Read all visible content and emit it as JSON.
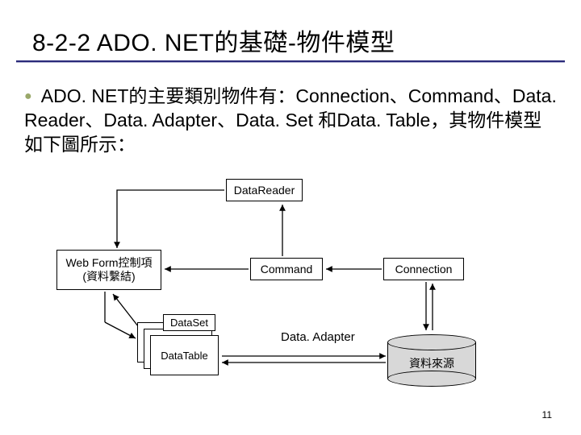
{
  "title": "8-2-2 ADO. NET的基礎-物件模型",
  "bullet": "ADO. NET的主要類別物件有：Connection、Command、Data. Reader、Data. Adapter、Data. Set 和Data. Table，其物件模型如下圖所示：",
  "diagram": {
    "datareader": "DataReader",
    "webform_line1": "Web Form控制項",
    "webform_line2": "(資料繫結)",
    "command": "Command",
    "connection": "Connection",
    "dataset": "DataSet",
    "datatable": "DataTable",
    "adapter": "Data. Adapter",
    "datasource": "資料來源"
  },
  "page_number": "11"
}
